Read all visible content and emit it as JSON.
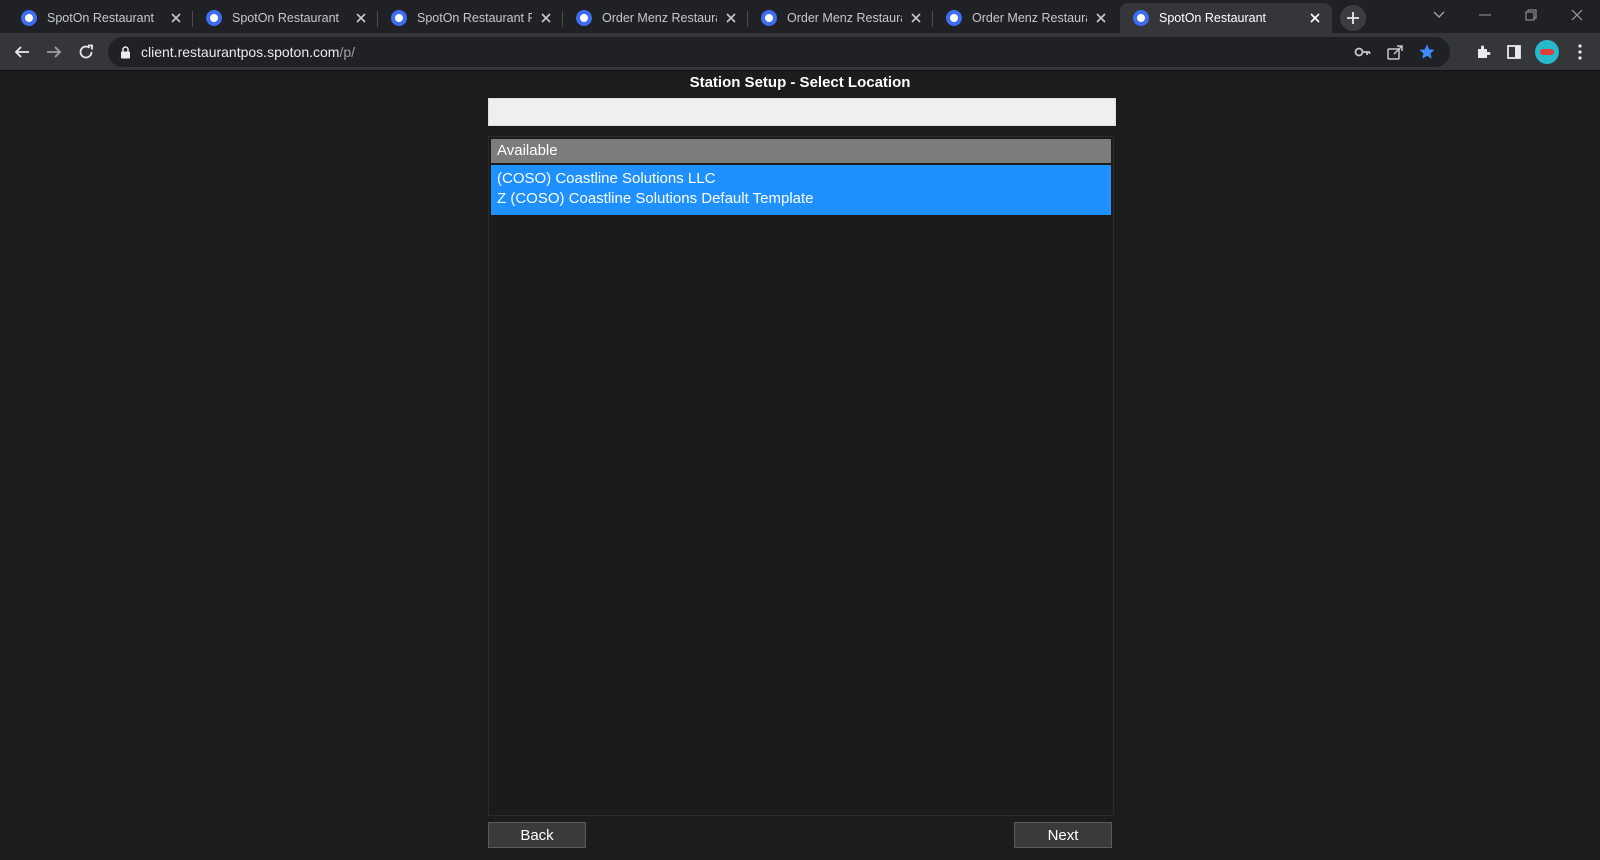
{
  "browser": {
    "tabs": [
      {
        "title": "SpotOn Restaurant",
        "active": false
      },
      {
        "title": "SpotOn Restaurant",
        "active": false
      },
      {
        "title": "SpotOn Restaurant Rep",
        "active": false
      },
      {
        "title": "Order Menz Restaurant",
        "active": false
      },
      {
        "title": "Order Menz Restaurant",
        "active": false
      },
      {
        "title": "Order Menz Restaurant",
        "active": false
      },
      {
        "title": "SpotOn Restaurant",
        "active": true
      }
    ],
    "url_host": "client.restaurantpos.spoton.com",
    "url_path": "/p/",
    "favicon_color": "#3f6df2"
  },
  "page": {
    "title": "Station Setup - Select Location",
    "filter": {
      "value": "",
      "placeholder": ""
    },
    "list": {
      "header": "Available",
      "selected_items": [
        "(COSO) Coastline Solutions LLC",
        "Z (COSO) Coastline Solutions Default Template"
      ]
    },
    "buttons": {
      "back": "Back",
      "next": "Next"
    }
  },
  "colors": {
    "page_background": "#1c1c1c",
    "selection": "#1e90ff",
    "list_header": "#7c7c7c"
  }
}
